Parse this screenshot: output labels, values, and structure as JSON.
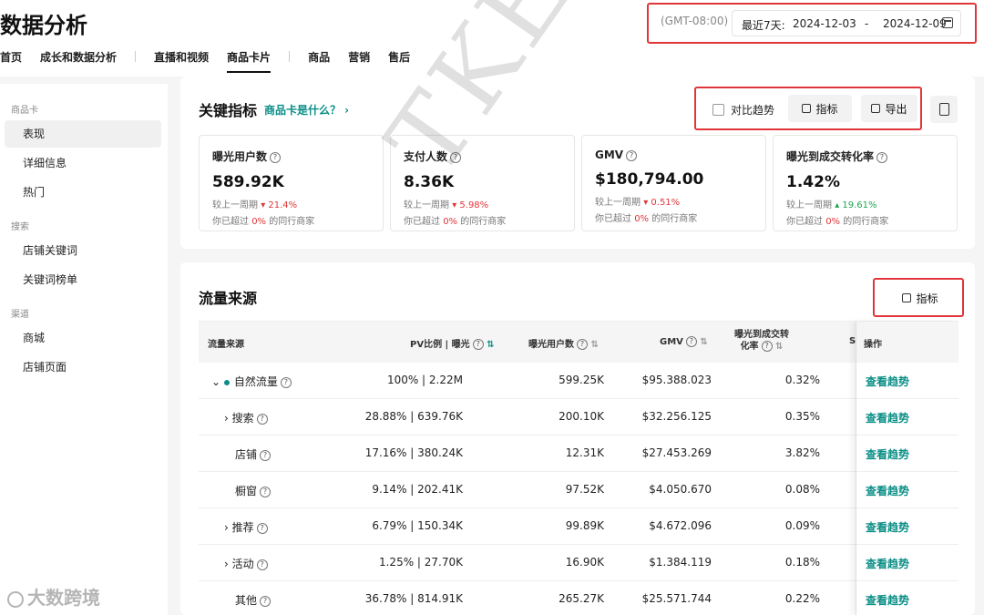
{
  "header": {
    "title": "数据分析",
    "nav": [
      "首页",
      "成长和数据分析",
      "直播和视频",
      "商品卡片",
      "商品",
      "营销",
      "售后"
    ],
    "active_nav": "商品卡片",
    "timezone": "(GMT-08:00)",
    "date_range_label": "最近7天:",
    "date_start": "2024-12-03",
    "date_sep": "-",
    "date_end": "2024-12-09"
  },
  "sidebar": {
    "groups": [
      {
        "title": "商品卡",
        "items": [
          "表现",
          "详细信息",
          "热门"
        ]
      },
      {
        "title": "搜索",
        "items": [
          "店铺关键词",
          "关键词榜单"
        ]
      },
      {
        "title": "渠道",
        "items": [
          "商城",
          "店铺页面"
        ]
      }
    ],
    "active_item": "表现"
  },
  "key_metrics": {
    "title": "关键指标",
    "what_is_link": "商品卡是什么？ ›",
    "compare_label": "对比趋势",
    "metrics_button": "指标",
    "export_button": "导出",
    "cards": [
      {
        "label": "曝光用户数",
        "value": "589.92K",
        "compare_text": "较上一周期",
        "change": "21.4%",
        "direction": "down",
        "beat_prefix": "你已超过",
        "beat_pct": "0%",
        "beat_suffix": "的同行商家"
      },
      {
        "label": "支付人数",
        "value": "8.36K",
        "compare_text": "较上一周期",
        "change": "5.98%",
        "direction": "down",
        "beat_prefix": "你已超过",
        "beat_pct": "0%",
        "beat_suffix": "的同行商家"
      },
      {
        "label": "GMV",
        "value": "$180,794.00",
        "compare_text": "较上一周期",
        "change": "0.51%",
        "direction": "down",
        "beat_prefix": "你已超过",
        "beat_pct": "0%",
        "beat_suffix": "的同行商家"
      },
      {
        "label": "曝光到成交转化率",
        "value": "1.42%",
        "compare_text": "较上一周期",
        "change": "19.61%",
        "direction": "up",
        "beat_prefix": "你已超过",
        "beat_pct": "0%",
        "beat_suffix": "的同行商家"
      }
    ]
  },
  "traffic": {
    "title": "流量来源",
    "metrics_button": "指标",
    "columns": {
      "source": "流量来源",
      "pv": "PV比例 | 曝光",
      "users": "曝光用户数",
      "gmv": "GMV",
      "cvr_line1": "曝光到成交转",
      "cvr_line2": "化率",
      "truncated": "S",
      "action": "操作"
    },
    "rows": [
      {
        "name": "自然流量",
        "pv": "100% | 2.22M",
        "users": "599.25K",
        "gmv": "$95.388.023",
        "cvr": "0.32%",
        "action": "查看趋势"
      },
      {
        "name": "搜索",
        "pv": "28.88% | 639.76K",
        "users": "200.10K",
        "gmv": "$32.256.125",
        "cvr": "0.35%",
        "action": "查看趋势"
      },
      {
        "name": "店铺",
        "pv": "17.16% | 380.24K",
        "users": "12.31K",
        "gmv": "$27.453.269",
        "cvr": "3.82%",
        "action": "查看趋势"
      },
      {
        "name": "橱窗",
        "pv": "9.14% | 202.41K",
        "users": "97.52K",
        "gmv": "$4.050.670",
        "cvr": "0.08%",
        "action": "查看趋势"
      },
      {
        "name": "推荐",
        "pv": "6.79% | 150.34K",
        "users": "99.89K",
        "gmv": "$4.672.096",
        "cvr": "0.09%",
        "action": "查看趋势"
      },
      {
        "name": "活动",
        "pv": "1.25% | 27.70K",
        "users": "16.90K",
        "gmv": "$1.384.119",
        "cvr": "0.18%",
        "action": "查看趋势"
      },
      {
        "name": "其他",
        "pv": "36.78% | 814.91K",
        "users": "265.27K",
        "gmv": "$25.571.744",
        "cvr": "0.22%",
        "action": "查看趋势"
      }
    ]
  },
  "watermarks": {
    "diagonal": "TKE",
    "brand": "大数跨境"
  },
  "colors": {
    "accent": "#0b8e86",
    "highlight_box": "#e0363b",
    "down": "#e0363b",
    "up": "#1ea454"
  }
}
